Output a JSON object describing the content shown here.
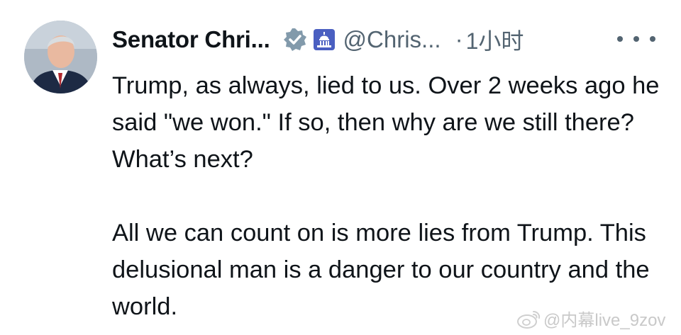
{
  "tweet": {
    "display_name": "Senator Chri...",
    "handle": "@Chris...",
    "separator": "·",
    "time": "1小时",
    "paragraphs": [
      "Trump, as always, lied to us. Over 2 weeks ago he said \"we won.\" If so, then why are we still there? What’s next?",
      "All we can count on is more lies from Trump. This delusional man is a danger to our country and the world."
    ],
    "icons": {
      "avatar": "avatar-photo",
      "verified": "verified-badge-icon",
      "affiliation": "capitol-building-icon",
      "more": "more-options-icon"
    },
    "colors": {
      "text": "#0f1419",
      "secondary": "#536471",
      "verified_gray": "#829aab",
      "gov_badge": "#4a5fc1"
    }
  },
  "watermark": {
    "text": "@内幕live_9zov",
    "icon": "weibo-icon"
  }
}
